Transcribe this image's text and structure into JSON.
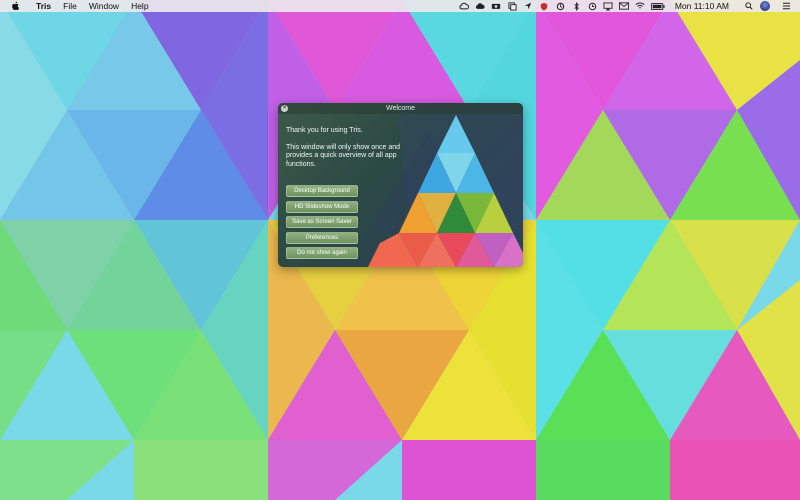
{
  "menubar": {
    "app_name": "Tris",
    "menus": [
      "File",
      "Window",
      "Help"
    ],
    "clock": "Mon 11:10 AM"
  },
  "welcome": {
    "title": "Welcome",
    "intro_line1": "Thank you for using Tris.",
    "intro_line2": "This window will only show once and provides a quick overview of all app functions.",
    "buttons": {
      "desktop_background": "Desktop Background",
      "hd_slideshow": "HD Slideshow Mode",
      "screen_saver": "Save as Screen Saver",
      "preferences": "Preferences",
      "do_not_show": "Do not show again"
    }
  },
  "colors": {
    "menubar_bg": "#ece8ec",
    "button_green": "#7fa16f",
    "window_bg": "#2f4a48"
  },
  "icons": [
    "apple-icon",
    "creative-cloud-icon",
    "upload-cloud-icon",
    "camera-icon",
    "copy-icon",
    "location-arrow-icon",
    "shield-icon",
    "sync-icon",
    "bluetooth-icon",
    "timemachine-icon",
    "airplay-icon",
    "mail-icon",
    "wifi-icon",
    "battery-icon",
    "spotlight-search-icon",
    "user-avatar-icon",
    "notification-list-icon"
  ]
}
